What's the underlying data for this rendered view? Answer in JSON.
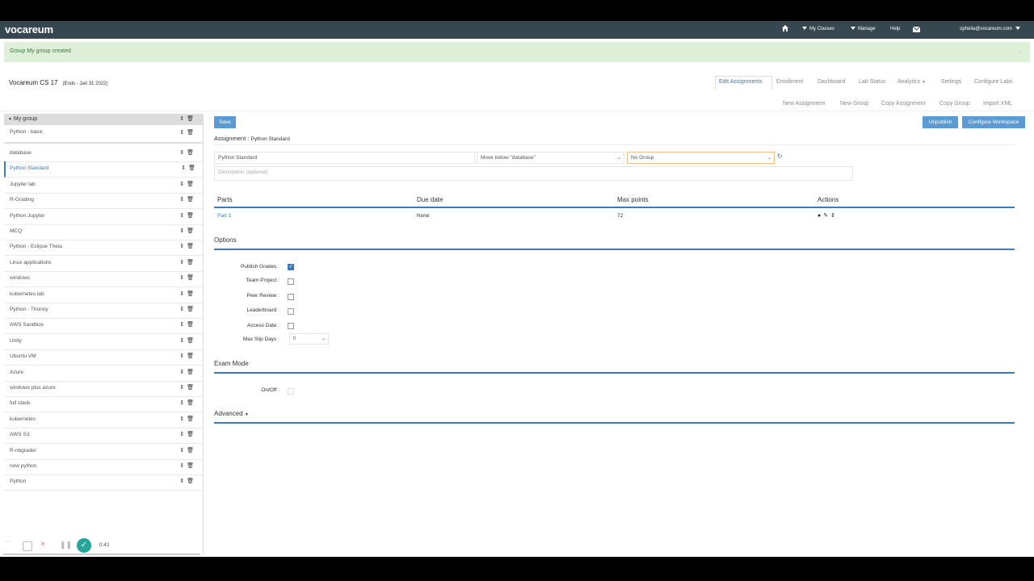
{
  "navbar": {
    "logo": "vocareum",
    "my_classes": "My Classes",
    "manage": "Manage",
    "help": "Help",
    "user": "ophelia@vocareum.com"
  },
  "alert": {
    "text": "Group My group created",
    "close": "×"
  },
  "course": {
    "title": "Vocareum CS 17",
    "ends": "(Ends - Jan 31 2022)"
  },
  "tabs": [
    "Edit Assignments",
    "Enrollment",
    "Dashboard",
    "Lab Status",
    "Analytics",
    "Settings",
    "Configure Labs"
  ],
  "sublinks": [
    "New Assignment",
    "New Group",
    "Copy Assignment",
    "Copy Group",
    "Import XML"
  ],
  "sidebar": {
    "group_name": "My group",
    "group_items": [
      "Python - basic"
    ],
    "items": [
      "database",
      "Python Standard",
      "Jupyter lab",
      "R-Grading",
      "Python Jupyter",
      "MCQ",
      "Python - Eclipse Theia",
      "Linux applications",
      "windows",
      "kubernetes lab",
      "Python - Thonny",
      "AWS Sandbox",
      "Unity",
      "Ubuntu VM",
      "Azure",
      "windows plus azure",
      "full stack",
      "kubernetes",
      "AWS S3",
      "R-nbgrader",
      "new python",
      "Python"
    ],
    "active": "Python Standard"
  },
  "buttons": {
    "save": "Save",
    "unpublish": "Unpublish",
    "configure_workspace": "Configure Workspace"
  },
  "assignment": {
    "label": "Assignment :",
    "name": "Python Standard",
    "name_value": "Python Standard",
    "move_select": "Move below \"database\"",
    "group_select": "No Group",
    "description_placeholder": "Description (optional)"
  },
  "parts_table": {
    "headers": [
      "Parts",
      "Due date",
      "Max points",
      "Actions"
    ],
    "rows": [
      {
        "part": "Part 1",
        "due": "None",
        "points": "72"
      }
    ]
  },
  "options": {
    "title": "Options",
    "items": [
      {
        "label": "Publish Grades :",
        "checked": true
      },
      {
        "label": "Team Project :",
        "checked": false
      },
      {
        "label": "Peer Review :",
        "checked": false
      },
      {
        "label": "Leaderboard :",
        "checked": false
      },
      {
        "label": "Access Date :",
        "checked": false
      }
    ],
    "max_slip_label": "Max Slip Days :",
    "max_slip_value": "0"
  },
  "exam": {
    "title": "Exam Mode",
    "onoff_label": "On/Off :"
  },
  "advanced": {
    "title": "Advanced"
  },
  "recorder": {
    "time": "0:42"
  },
  "colors": {
    "navbar": "#37474f",
    "accent": "#5b9bd5",
    "line": "#3e7ab5",
    "alert_bg": "#dff0d8"
  }
}
